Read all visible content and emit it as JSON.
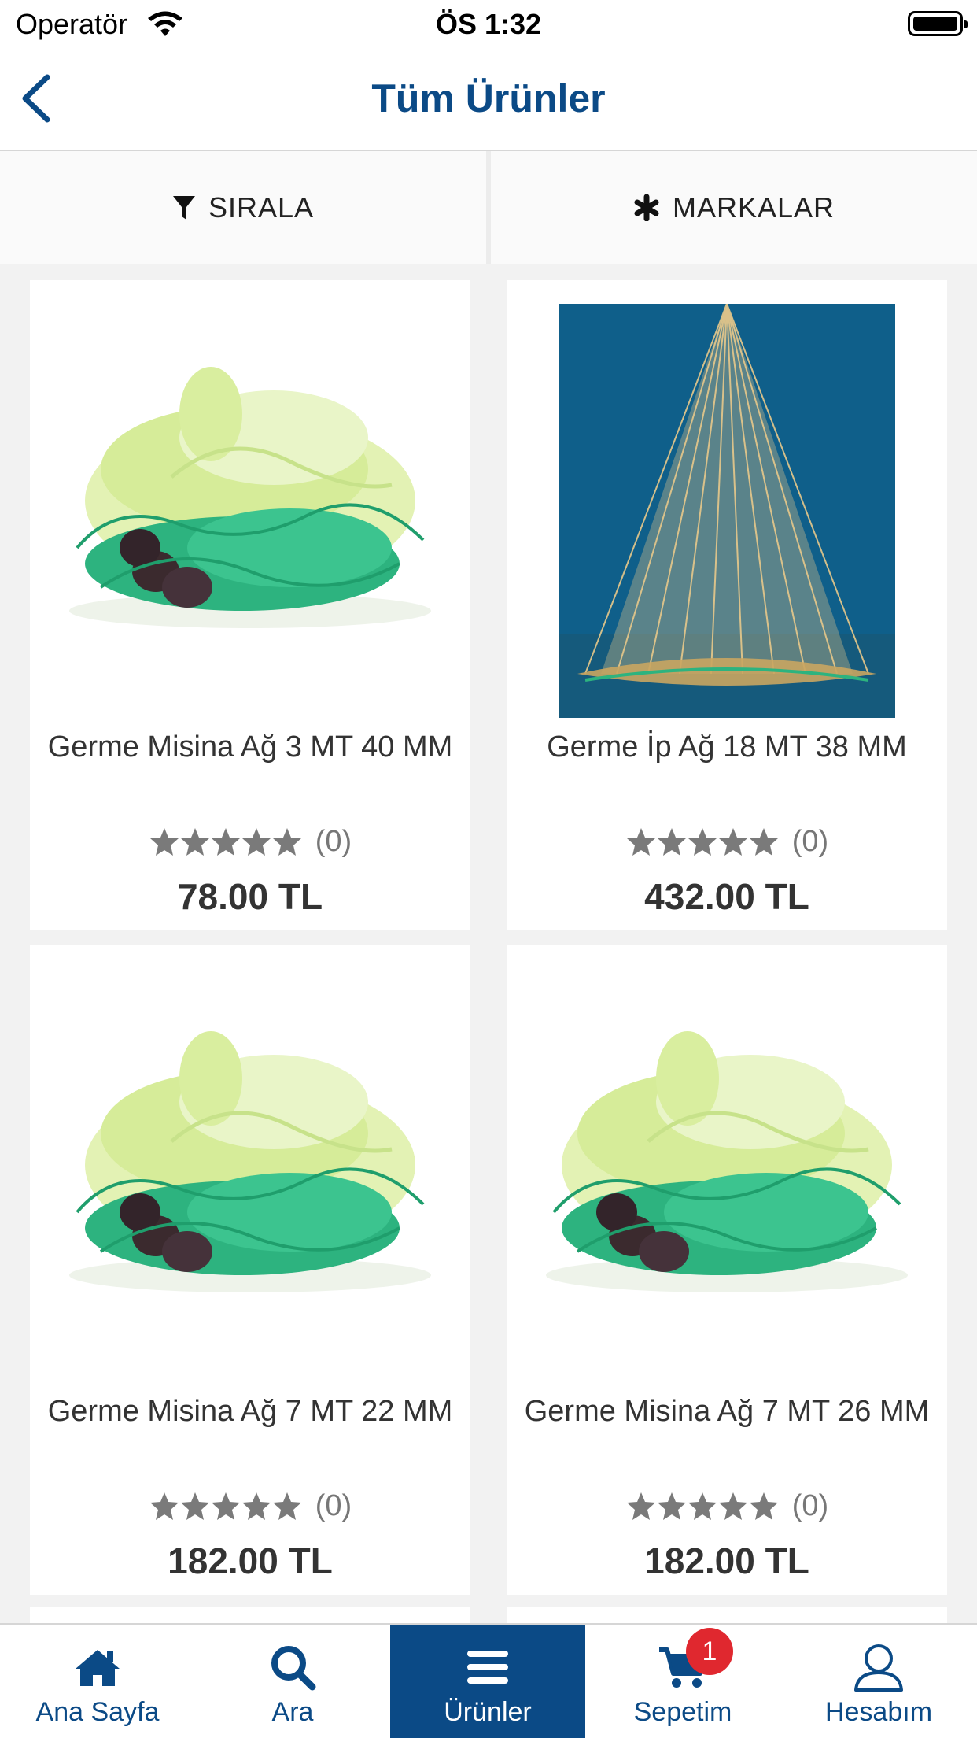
{
  "status_bar": {
    "carrier": "Operatör",
    "time": "ÖS 1:32"
  },
  "nav": {
    "title": "Tüm Ürünler"
  },
  "filters": {
    "sort_label": "SIRALA",
    "brands_label": "MARKALAR"
  },
  "products": [
    {
      "name": "Germe Misina Ağ 3 MT 40 MM",
      "rating_count": "(0)",
      "price": "78.00 TL",
      "image": "green-net-bundle"
    },
    {
      "name": "Germe İp Ağ 18 MT 38 MM",
      "rating_count": "(0)",
      "price": "432.00 TL",
      "image": "cast-net-on-blue"
    },
    {
      "name": "Germe Misina Ağ 7 MT 22 MM",
      "rating_count": "(0)",
      "price": "182.00 TL",
      "image": "green-net-bundle"
    },
    {
      "name": "Germe Misina Ağ 7 MT 26 MM",
      "rating_count": "(0)",
      "price": "182.00 TL",
      "image": "green-net-bundle"
    }
  ],
  "tab_bar": {
    "home": "Ana Sayfa",
    "search": "Ara",
    "products": "Ürünler",
    "cart": "Sepetim",
    "cart_badge": "1",
    "account": "Hesabım"
  },
  "colors": {
    "brand": "#0b4a86",
    "badge": "#e0282f",
    "star": "#7a7a7a",
    "net_green": "#2db37f",
    "net_blue_bg": "#0f5f8a"
  }
}
